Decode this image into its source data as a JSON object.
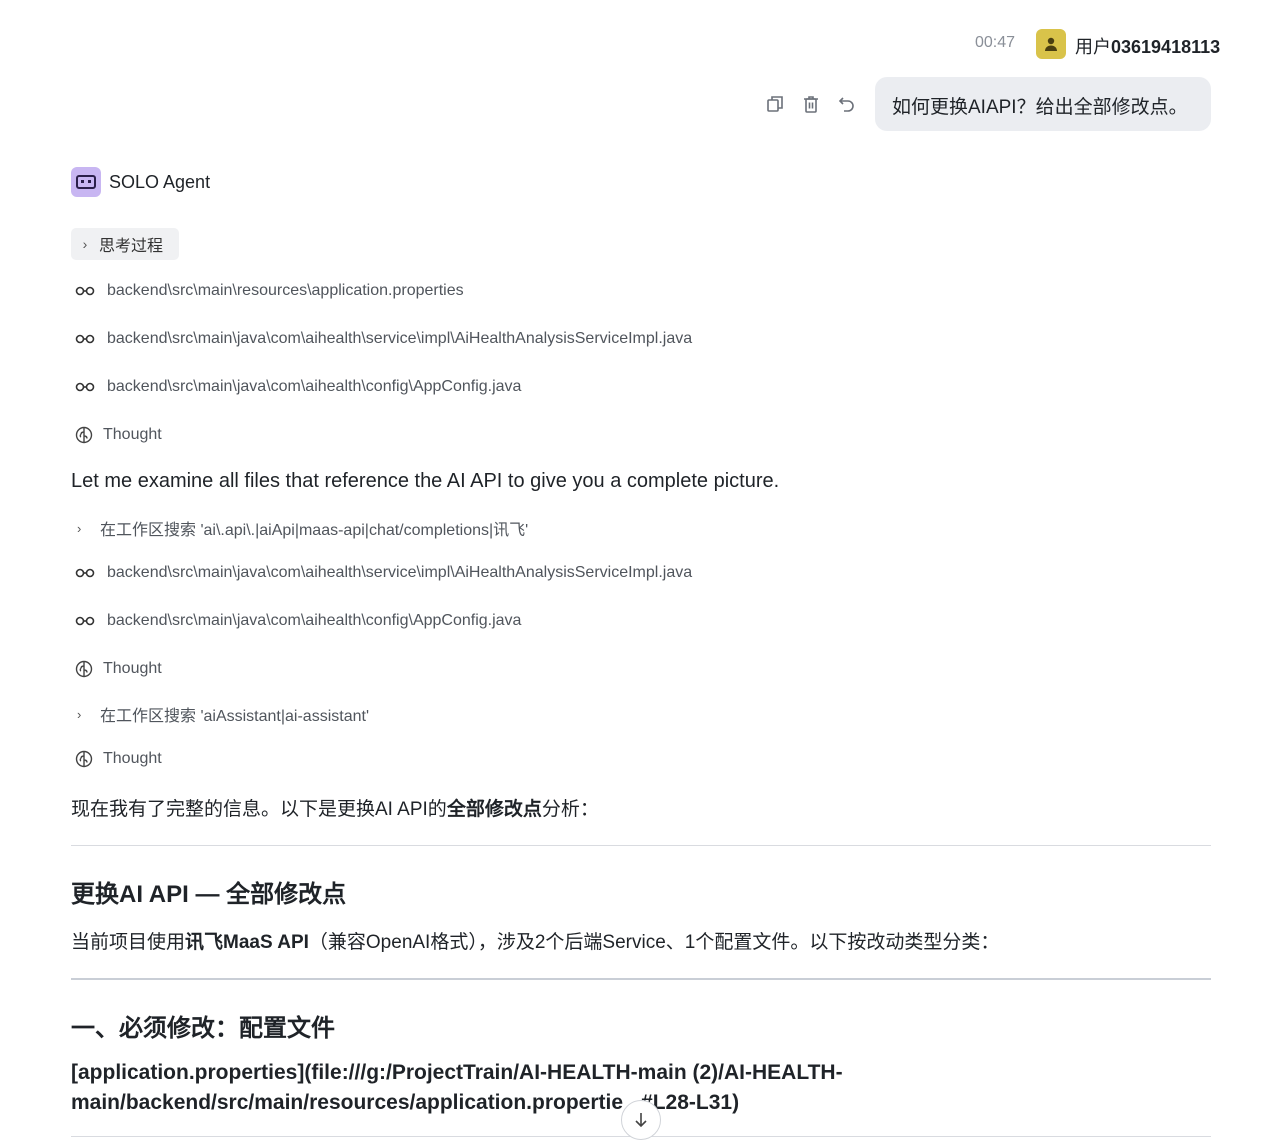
{
  "header": {
    "time": "00:47",
    "user_prefix": "用户",
    "user_id": "03619418113"
  },
  "user_message": {
    "text": "如何更换AIAPI？给出全部修改点。",
    "actions": [
      "copy-icon",
      "delete-icon",
      "undo-icon"
    ]
  },
  "agent": {
    "name": "SOLO Agent",
    "thinking_label": "思考过程"
  },
  "steps": {
    "read1": "backend\\src\\main\\resources\\application.properties",
    "read2": "backend\\src\\main\\java\\com\\aihealth\\service\\impl\\AiHealthAnalysisServiceImpl.java",
    "read3": "backend\\src\\main\\java\\com\\aihealth\\config\\AppConfig.java",
    "thought1": "Thought",
    "statement": "Let me examine all files that reference the AI API to give you a complete picture.",
    "search1": "在工作区搜索 'ai\\.api\\.|aiApi|maas-api|chat/completions|讯飞'",
    "read4": "backend\\src\\main\\java\\com\\aihealth\\service\\impl\\AiHealthAnalysisServiceImpl.java",
    "read5": "backend\\src\\main\\java\\com\\aihealth\\config\\AppConfig.java",
    "thought2": "Thought",
    "search2": "在工作区搜索 'aiAssistant|ai-assistant'",
    "thought3": "Thought"
  },
  "answer": {
    "intro_pre": "现在我有了完整的信息。以下是更换AI API的",
    "intro_bold": "全部修改点",
    "intro_post": "分析：",
    "title": "更换AI API — 全部修改点",
    "desc_pre": "当前项目使用",
    "desc_bold": "讯飞MaaS API",
    "desc_post": "（兼容OpenAI格式），涉及2个后端Service、1个配置文件。以下按改动类型分类：",
    "section1": "一、必须修改：配置文件",
    "link_line1": "[application.properties](file:///g:/ProjectTrain/AI-HEALTH-main (2)/AI-HEALTH-",
    "link_line2": "main/backend/src/main/resources/application.propertie",
    "link_line2_tail": "#L28-L31)"
  },
  "colors": {
    "bubble_bg": "#ebedf1",
    "avatar_bg": "#d9c34a",
    "agent_icon_bg": "#c8b6f2",
    "chip_bg": "#f0f1f3"
  }
}
